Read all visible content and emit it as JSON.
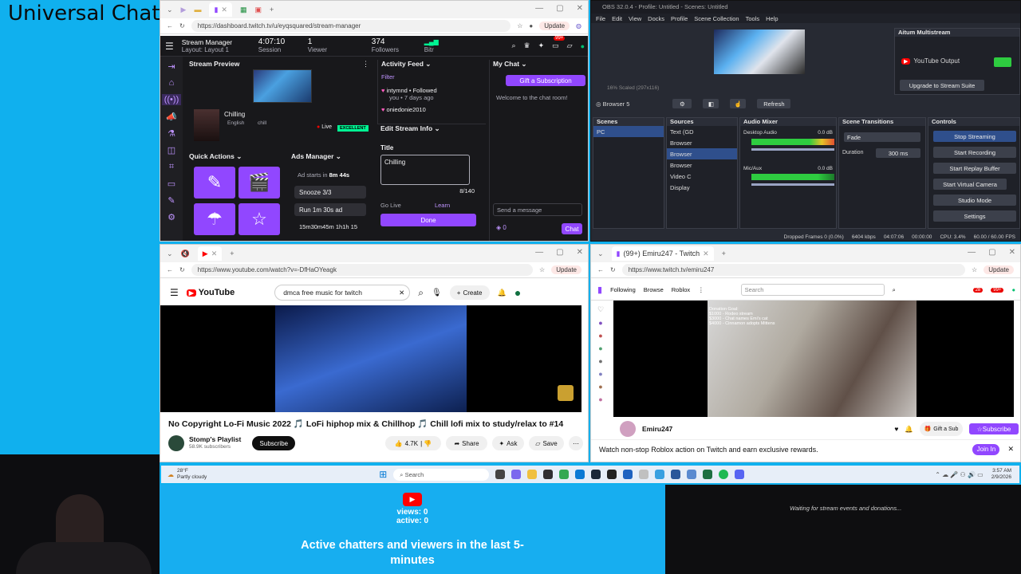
{
  "overlay_title": "Universal Chat",
  "twitch_dash": {
    "url": "https://dashboard.twitch.tv/u/eyqsquared/stream-manager",
    "update": "Update",
    "header": {
      "title": "Stream Manager",
      "layout": "Layout: Layout 1",
      "session_value": "4:07:10",
      "session_label": "Session",
      "viewers_value": "1",
      "viewers_label": "Viewer",
      "followers_value": "374",
      "followers_label": "Followers",
      "bitrate_label": "Bitr",
      "badge": "99+"
    },
    "stream_preview": {
      "title": "Stream Preview",
      "stream_name": "Chilling",
      "language": "English",
      "tag": "chill",
      "live": "Live",
      "quality": "EXCELLENT"
    },
    "quick_actions": {
      "title": "Quick Actions"
    },
    "ads": {
      "title": "Ads Manager",
      "ad_starts": "Ad starts in",
      "ad_time": "8m 44s",
      "snooze": "Snooze 3/3",
      "run": "Run 1m 30s ad",
      "timer": "15m30m45m",
      "timer2": "1h1h 15"
    },
    "activity": {
      "title": "Activity Feed",
      "filter": "Filter",
      "user1": "intymnd • Followed",
      "user1_sub": "you • 7 days ago",
      "user2": "oniedonie2010"
    },
    "edit_info": {
      "title": "Edit Stream Info",
      "title_label": "Title",
      "title_value": "Chilling",
      "counter": "8/140",
      "go_live": "Go Live",
      "learn": "Learn",
      "done": "Done"
    },
    "chat": {
      "title": "My Chat",
      "gift": "Gift a Subscription",
      "welcome": "Welcome to the chat room!",
      "placeholder": "Send a message",
      "points": "0",
      "chat_btn": "Chat"
    }
  },
  "obs": {
    "title": "OBS 32.0.4 - Profile: Untitled - Scenes: Untitled",
    "menu": [
      "File",
      "Edit",
      "View",
      "Docks",
      "Profile",
      "Scene Collection",
      "Tools",
      "Help"
    ],
    "multistream": {
      "title": "Aitum Multistream",
      "yt_output": "YouTube Output",
      "upgrade": "Upgrade to Stream Suite"
    },
    "preview_info": "16%  Scaled (297x116)",
    "source_bar": {
      "name": "Browser 5",
      "refresh": "Refresh"
    },
    "scenes": {
      "title": "Scenes",
      "items": [
        "PC"
      ]
    },
    "sources": {
      "title": "Sources",
      "items": [
        "Text (GD",
        "Browser",
        "Browser",
        "Browser",
        "Video C",
        "Display"
      ]
    },
    "mixer": {
      "title": "Audio Mixer",
      "ch1": "Desktop Audio",
      "ch1_db": "0.0 dB",
      "ch2": "Mic/Aux",
      "ch2_db": "0.0 dB"
    },
    "transitions": {
      "title": "Scene Transitions",
      "type": "Fade",
      "duration_label": "Duration",
      "duration": "300 ms"
    },
    "controls": {
      "title": "Controls",
      "buttons": [
        "Stop Streaming",
        "Start Recording",
        "Start Replay Buffer",
        "Start Virtual Camera",
        "Studio Mode",
        "Settings"
      ]
    },
    "status": {
      "dropped": "Dropped Frames 0 (0.0%)",
      "bitrate": "6404 kbps",
      "stream_time": "04:07:06",
      "rec_time": "00:00:00",
      "cpu": "CPU: 3.4%",
      "fps": "60.00 / 60.00 FPS"
    }
  },
  "youtube": {
    "url": "https://www.youtube.com/watch?v=-DfHaOYeagk",
    "update": "Update",
    "search": "dmca free music for twitch",
    "create": "Create",
    "video_title": "No Copyright Lo-Fi Music 2022 🎵 LoFi hiphop mix & Chillhop 🎵 Chill lofi mix to study/relax to #14",
    "channel": "Stomp's Playlist",
    "subs": "58.9K subscribers",
    "subscribe": "Subscribe",
    "likes": "4.7K",
    "share": "Share",
    "ask": "Ask",
    "save": "Save"
  },
  "twitch_viewer": {
    "tab": "(99+) Emiru247 - Twitch",
    "url": "https://www.twitch.tv/emiru247",
    "update": "Update",
    "nav": [
      "Following",
      "Browse",
      "Roblox"
    ],
    "search": "Search",
    "badge1": "28",
    "badge2": "99+",
    "donation": "Donation Goal:\n$1000 - Rodeo stream\n$3000 - Chat names Emi's cat\n$4000 - Cinnamon adopts Mittens",
    "streamer": "Emiru247",
    "gift": "Gift a Sub",
    "subscribe": "Subscribe",
    "banner": "Watch non-stop Roblox action on Twitch and earn exclusive rewards.",
    "join": "Join In"
  },
  "taskbar": {
    "temp": "28°F",
    "weather": "Partly cloudy",
    "search": "Search",
    "time": "3:57 AM",
    "date": "2/9/2026"
  },
  "viewers_widget": {
    "views": "views: 0",
    "active": "active: 0",
    "caption": "Active chatters and viewers in the last 5-minutes"
  },
  "events_widget": {
    "text": "Waiting for stream events and donations..."
  },
  "colors": {
    "twitch_purple": "#9147ff",
    "obs_bg": "#272a33",
    "overlay_blue": "#10b0ee",
    "youtube_red": "#ff0000",
    "live_green": "#00f593"
  }
}
